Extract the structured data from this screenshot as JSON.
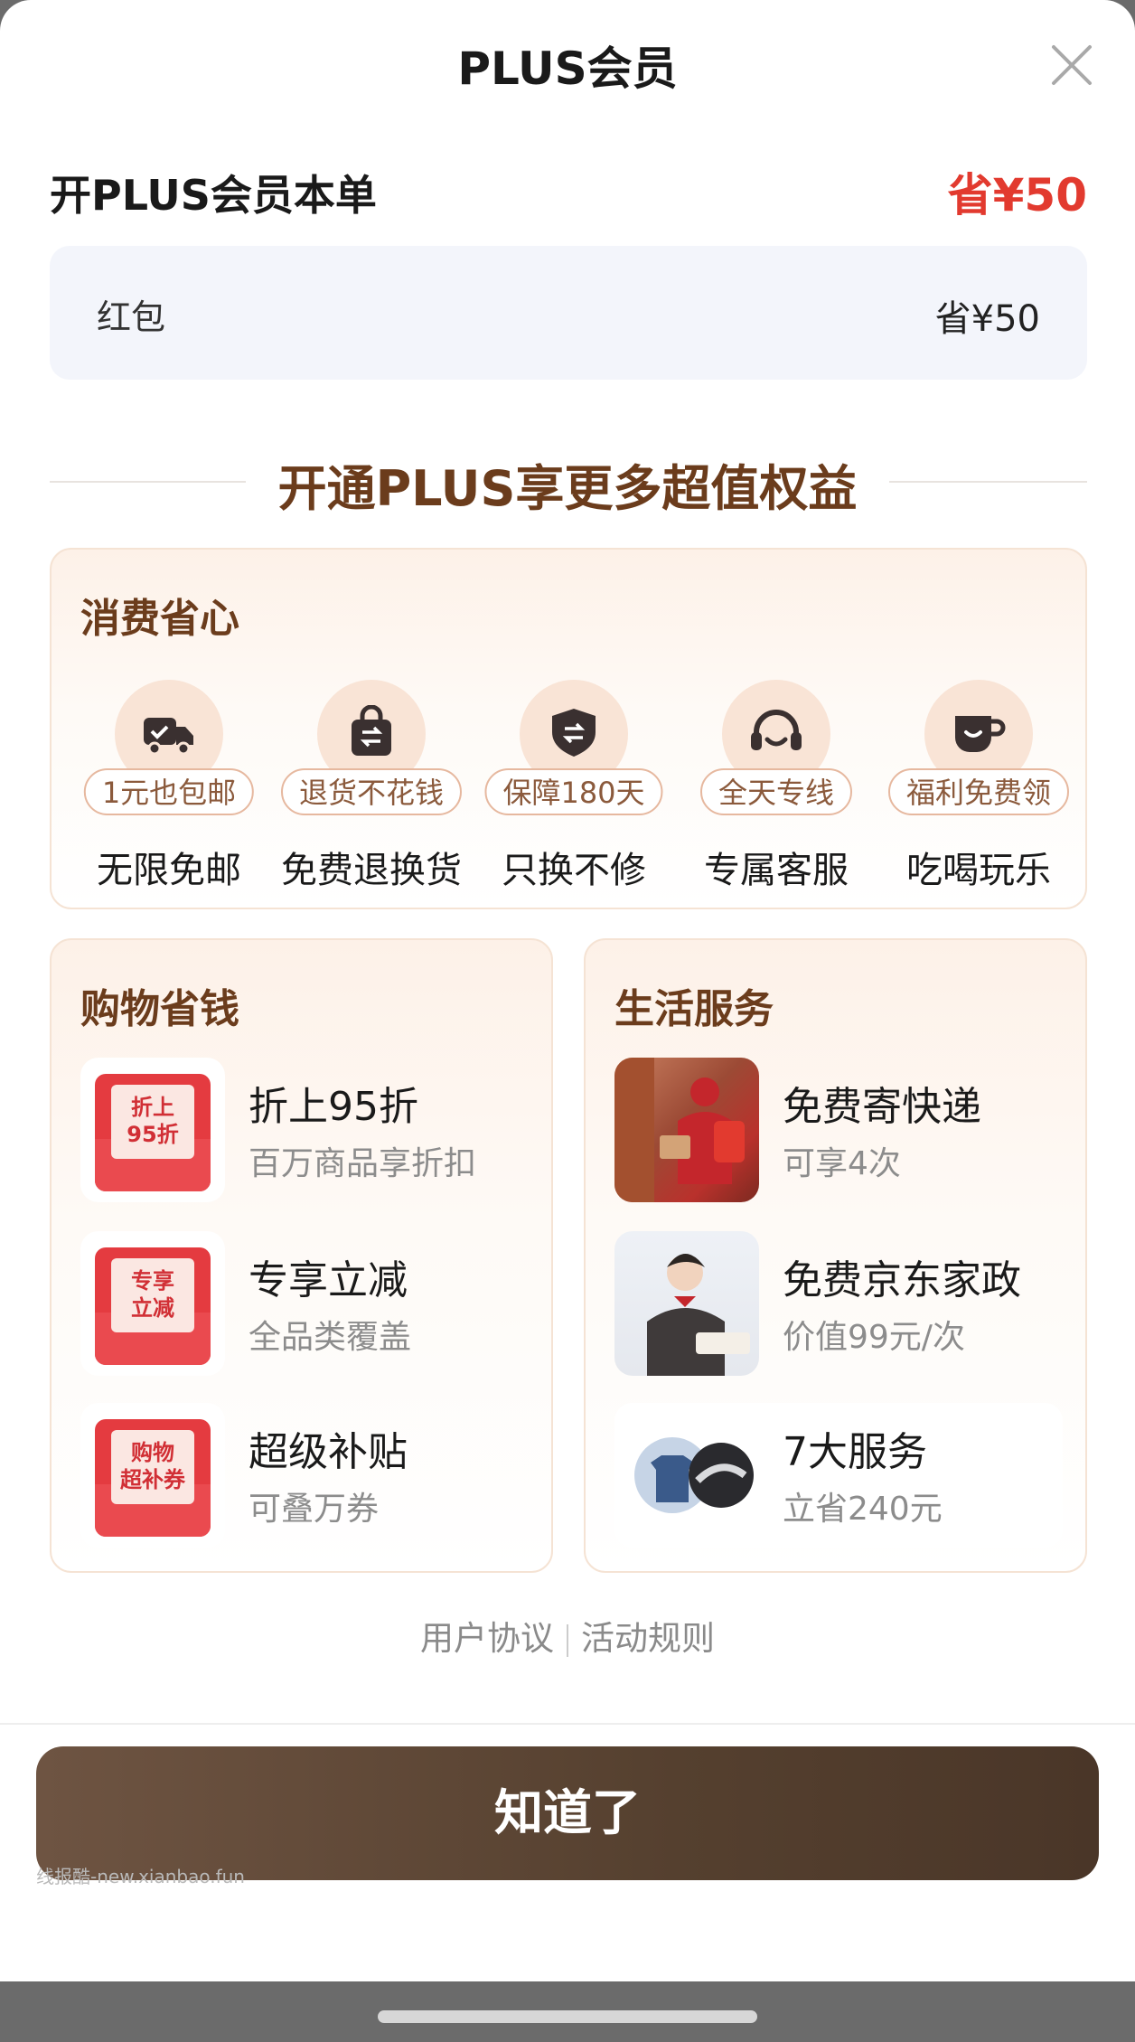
{
  "header": {
    "title": "PLUS会员"
  },
  "summary": {
    "label": "开PLUS会员本单",
    "value": "省¥50"
  },
  "red_packet": {
    "label": "红包",
    "value": "省¥50"
  },
  "section_title": "开通PLUS享更多超值权益",
  "consume": {
    "title": "消费省心",
    "items": [
      {
        "tag": "1元也包邮",
        "name": "无限免邮",
        "icon": "truck-icon"
      },
      {
        "tag": "退货不花钱",
        "name": "免费退换货",
        "icon": "bag-icon"
      },
      {
        "tag": "保障180天",
        "name": "只换不修",
        "icon": "shield-icon"
      },
      {
        "tag": "全天专线",
        "name": "专属客服",
        "icon": "headset-icon"
      },
      {
        "tag": "福利免费领",
        "name": "吃喝玩乐",
        "icon": "cup-icon"
      }
    ]
  },
  "shopping": {
    "title": "购物省钱",
    "items": [
      {
        "badge": "折上95折",
        "title": "折上95折",
        "sub": "百万商品享折扣"
      },
      {
        "badge": "专享立减",
        "title": "专享立减",
        "sub": "全品类覆盖"
      },
      {
        "badge": "购物超补券",
        "title": "超级补贴",
        "sub": "可叠万券"
      }
    ]
  },
  "life": {
    "title": "生活服务",
    "items": [
      {
        "title": "免费寄快递",
        "sub": "可享4次"
      },
      {
        "title": "免费京东家政",
        "sub": "价值99元/次"
      },
      {
        "title": "7大服务",
        "sub": "立省240元"
      }
    ]
  },
  "footer_links": {
    "agreement": "用户协议",
    "rules": "活动规则"
  },
  "cta": {
    "label": "知道了"
  },
  "watermark": "线报酷-new.xianbao.fun",
  "colors": {
    "accent_red": "#e23a2f",
    "brown": "#6b3c1c",
    "cta_brown": "#5a4333"
  }
}
